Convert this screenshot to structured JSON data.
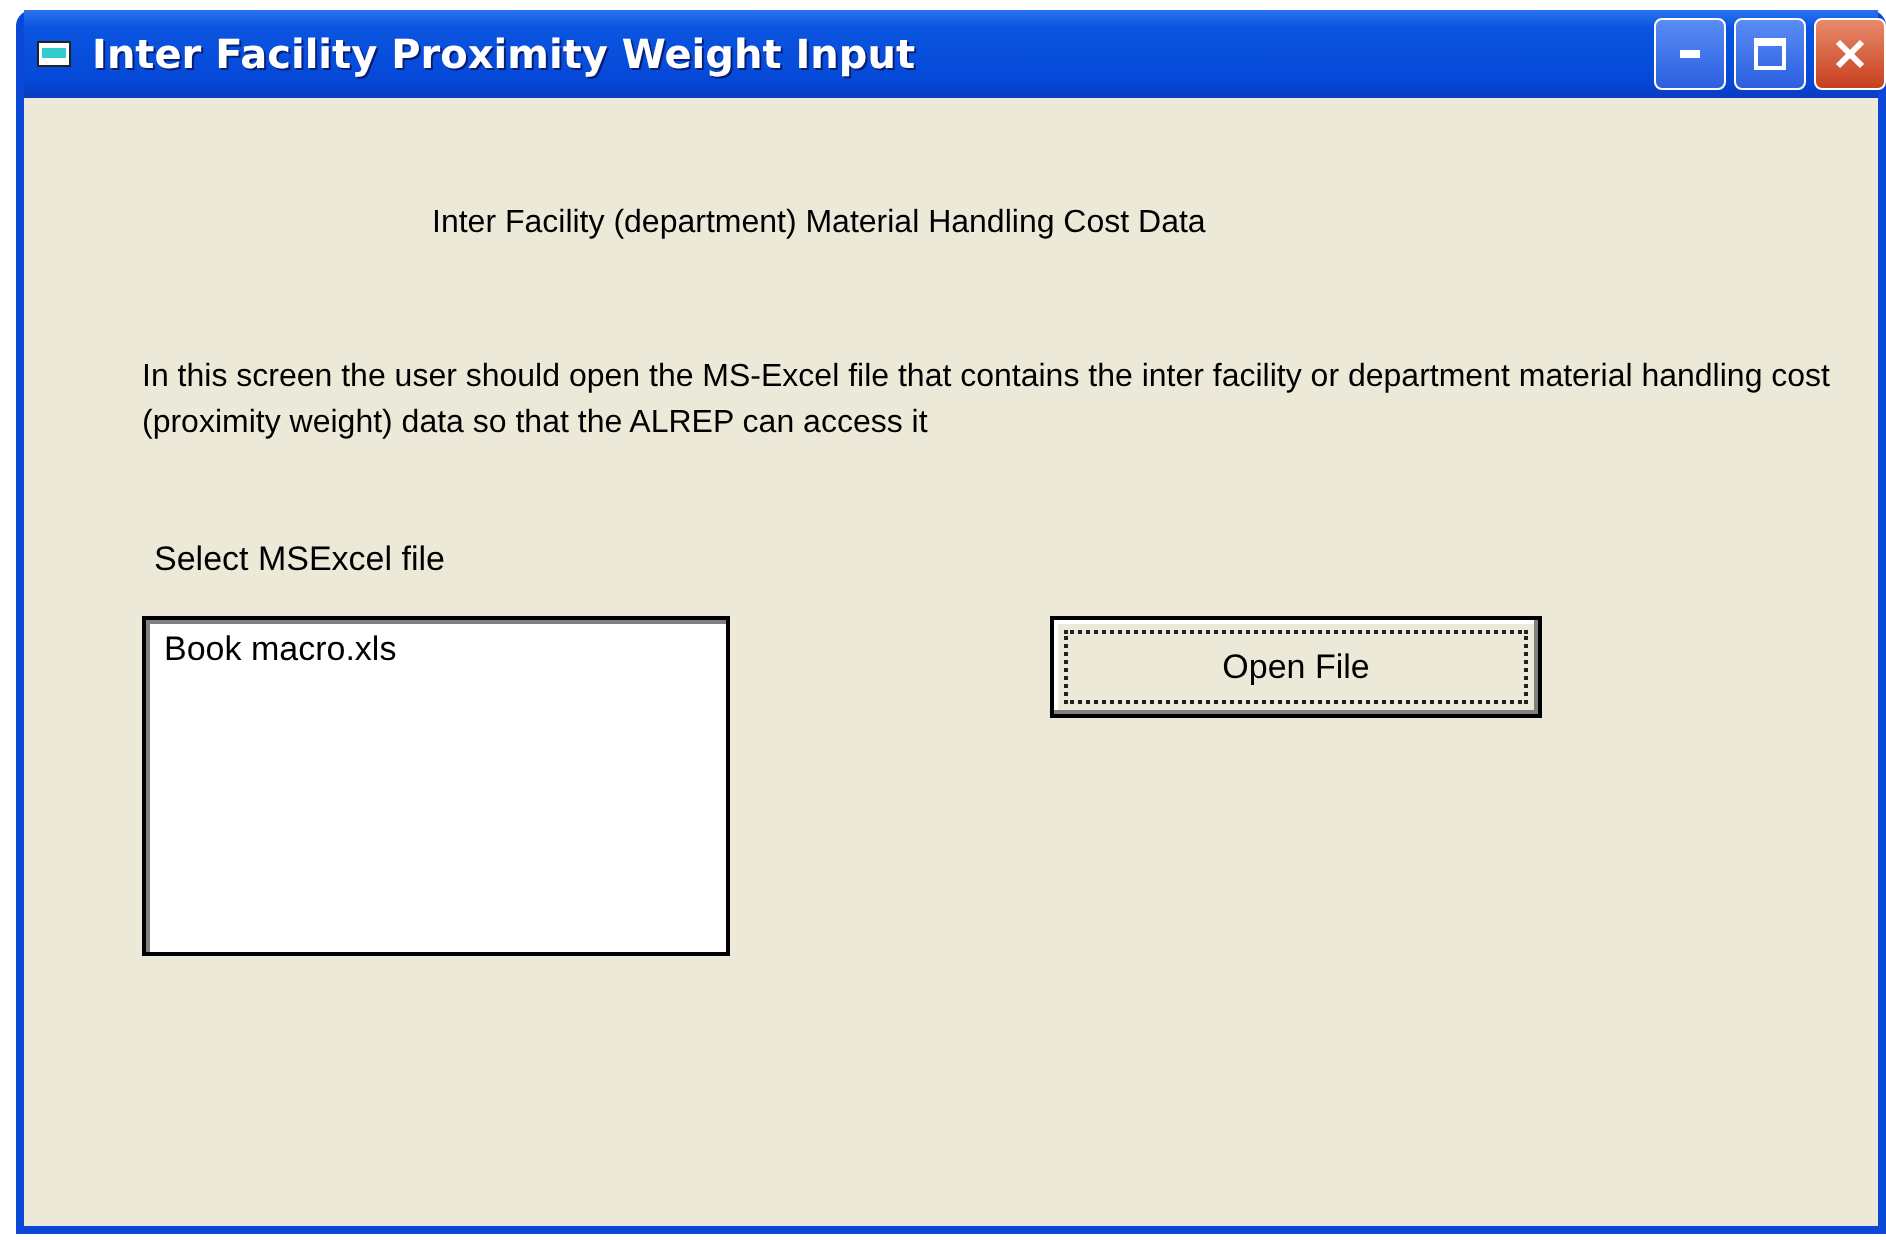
{
  "window": {
    "title": "Inter Facility Proximity Weight Input"
  },
  "heading": "Inter Facility (department) Material Handling Cost Data",
  "description": "In this screen the user should open the MS-Excel file that contains the inter facility or department material handling cost (proximity weight) data so that the ALREP can access it",
  "file_label": "Select MSExcel file",
  "file_list": {
    "items": [
      {
        "label": "Book macro.xls",
        "selected": false
      }
    ]
  },
  "open_button": {
    "label": "Open File",
    "focused": true
  }
}
